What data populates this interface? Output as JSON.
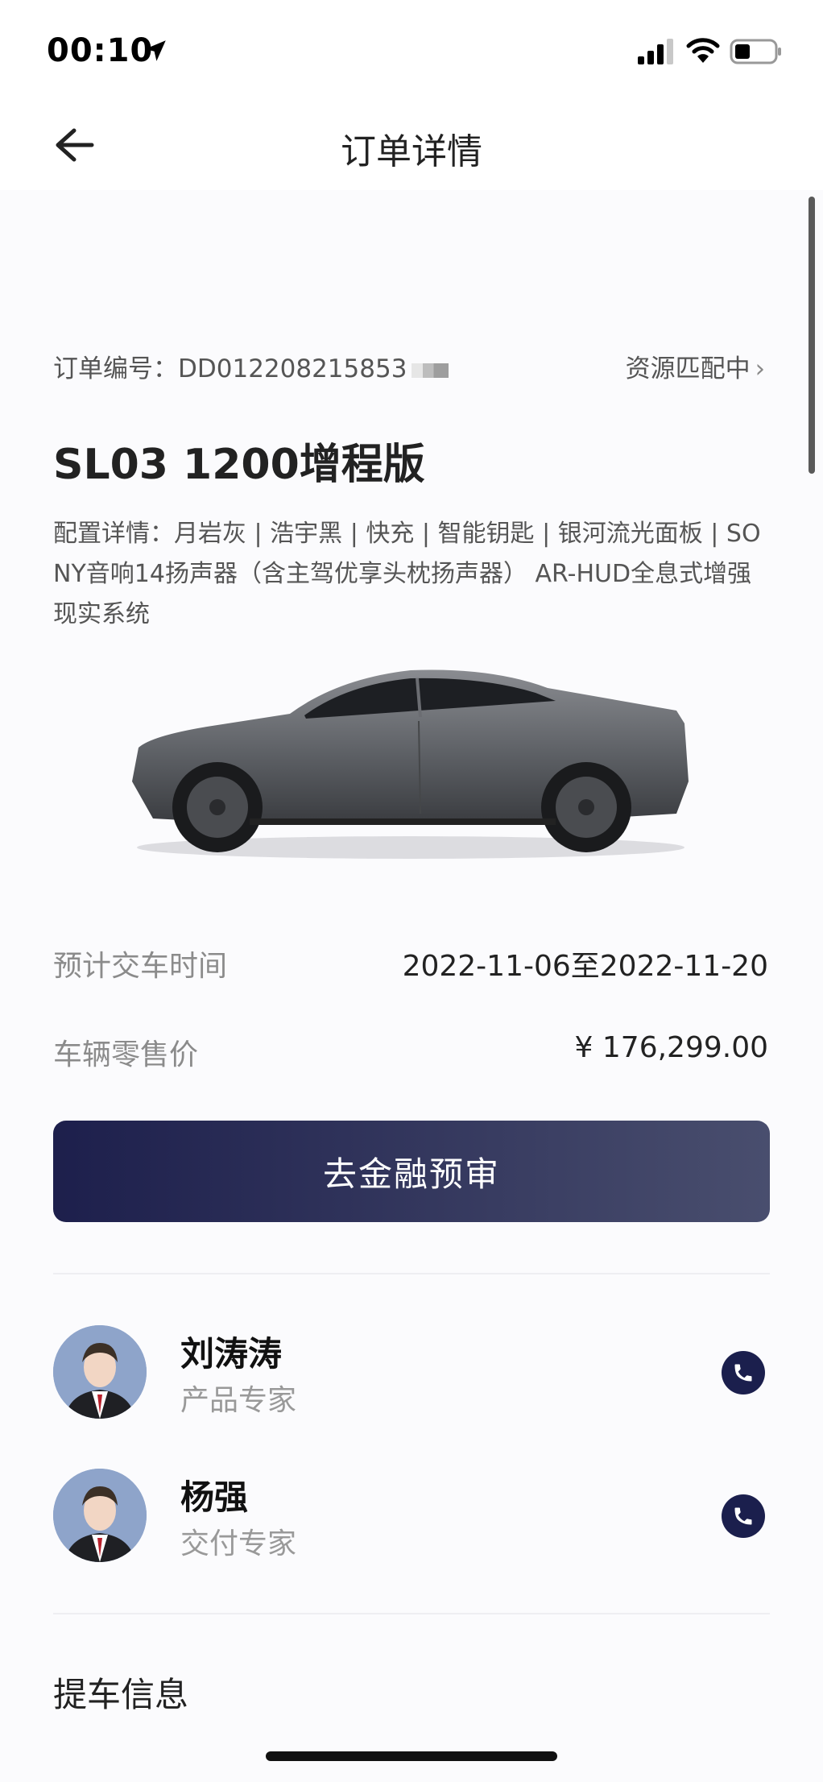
{
  "status_bar": {
    "time": "00:10",
    "icons": [
      "location-arrow-icon",
      "signal-icon",
      "wifi-icon",
      "battery-icon"
    ]
  },
  "header": {
    "title": "订单详情",
    "back_icon": "back-arrow-icon"
  },
  "order": {
    "number_label": "订单编号：",
    "number_value": "DD012208215853",
    "status": "资源匹配中",
    "status_chevron": "›",
    "model_name": "SL03 1200增程版",
    "config_text": "配置详情：月岩灰 | 浩宇黑 | 快充 | 智能钥匙 | 银河流光面板 | SONY音响14扬声器（含主驾优享头枕扬声器） AR-HUD全息式增强现实系统"
  },
  "details": {
    "delivery_label": "预计交车时间",
    "delivery_value": "2022-11-06至2022-11-20",
    "price_label": "车辆零售价",
    "price_value": "¥ 176,299.00"
  },
  "finance_button": "去金融预审",
  "contacts": [
    {
      "name": "刘涛涛",
      "role": "产品专家",
      "icon": "phone-icon"
    },
    {
      "name": "杨强",
      "role": "交付专家",
      "icon": "phone-icon"
    }
  ],
  "pickup": {
    "title": "提车信息"
  },
  "colors": {
    "button_start": "#1d1f4c",
    "button_end": "#494e6e",
    "phone_button": "#1b1f4d",
    "background": "#fbfbfd"
  }
}
